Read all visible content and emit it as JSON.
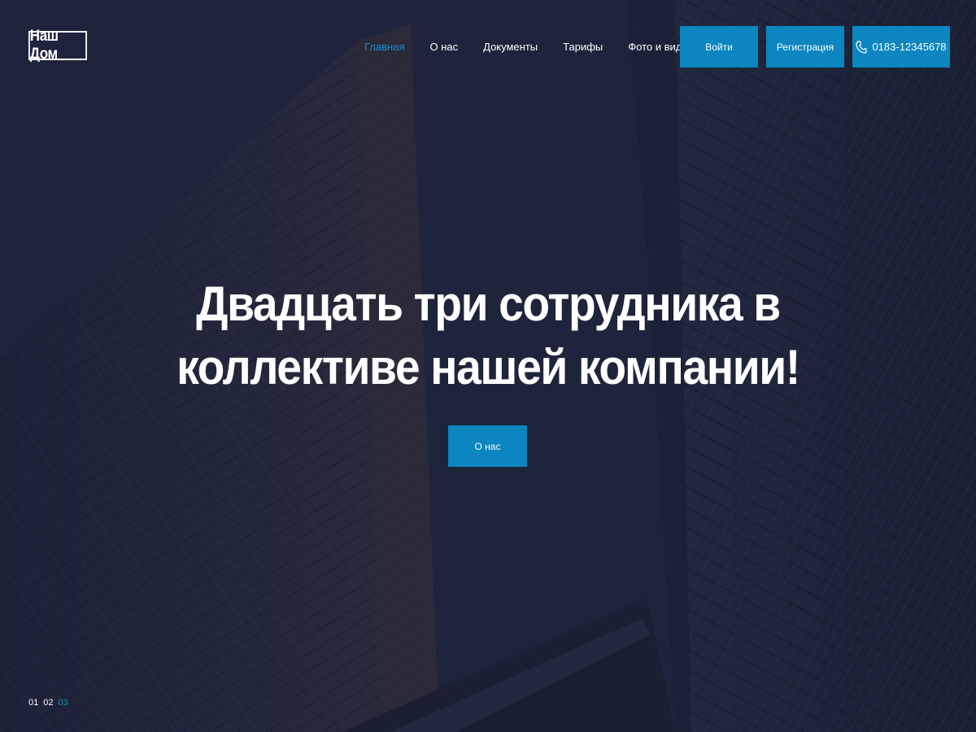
{
  "brand": {
    "logo_text": "Наш Дом"
  },
  "nav": {
    "items": [
      {
        "label": "Главная",
        "active": true
      },
      {
        "label": "О нас",
        "active": false
      },
      {
        "label": "Документы",
        "active": false
      },
      {
        "label": "Тарифы",
        "active": false
      },
      {
        "label": "Фото и видео",
        "active": false
      }
    ]
  },
  "header_buttons": {
    "login": "Войти",
    "register": "Регистрация",
    "phone": "0183-12345678",
    "phone_icon": "phone-icon"
  },
  "hero": {
    "headline_line1": "Двадцать три сотрудника в",
    "headline_line2": "коллективе нашей компании!",
    "cta_label": "О нас",
    "background": "skyscrapers-photo"
  },
  "slider": {
    "pages": [
      "01",
      "02",
      "03"
    ],
    "active_index": 2
  },
  "colors": {
    "accent": "#0b86c0",
    "active_link": "#1a8cc6",
    "overlay": "#1d2338",
    "text": "#ffffff"
  }
}
